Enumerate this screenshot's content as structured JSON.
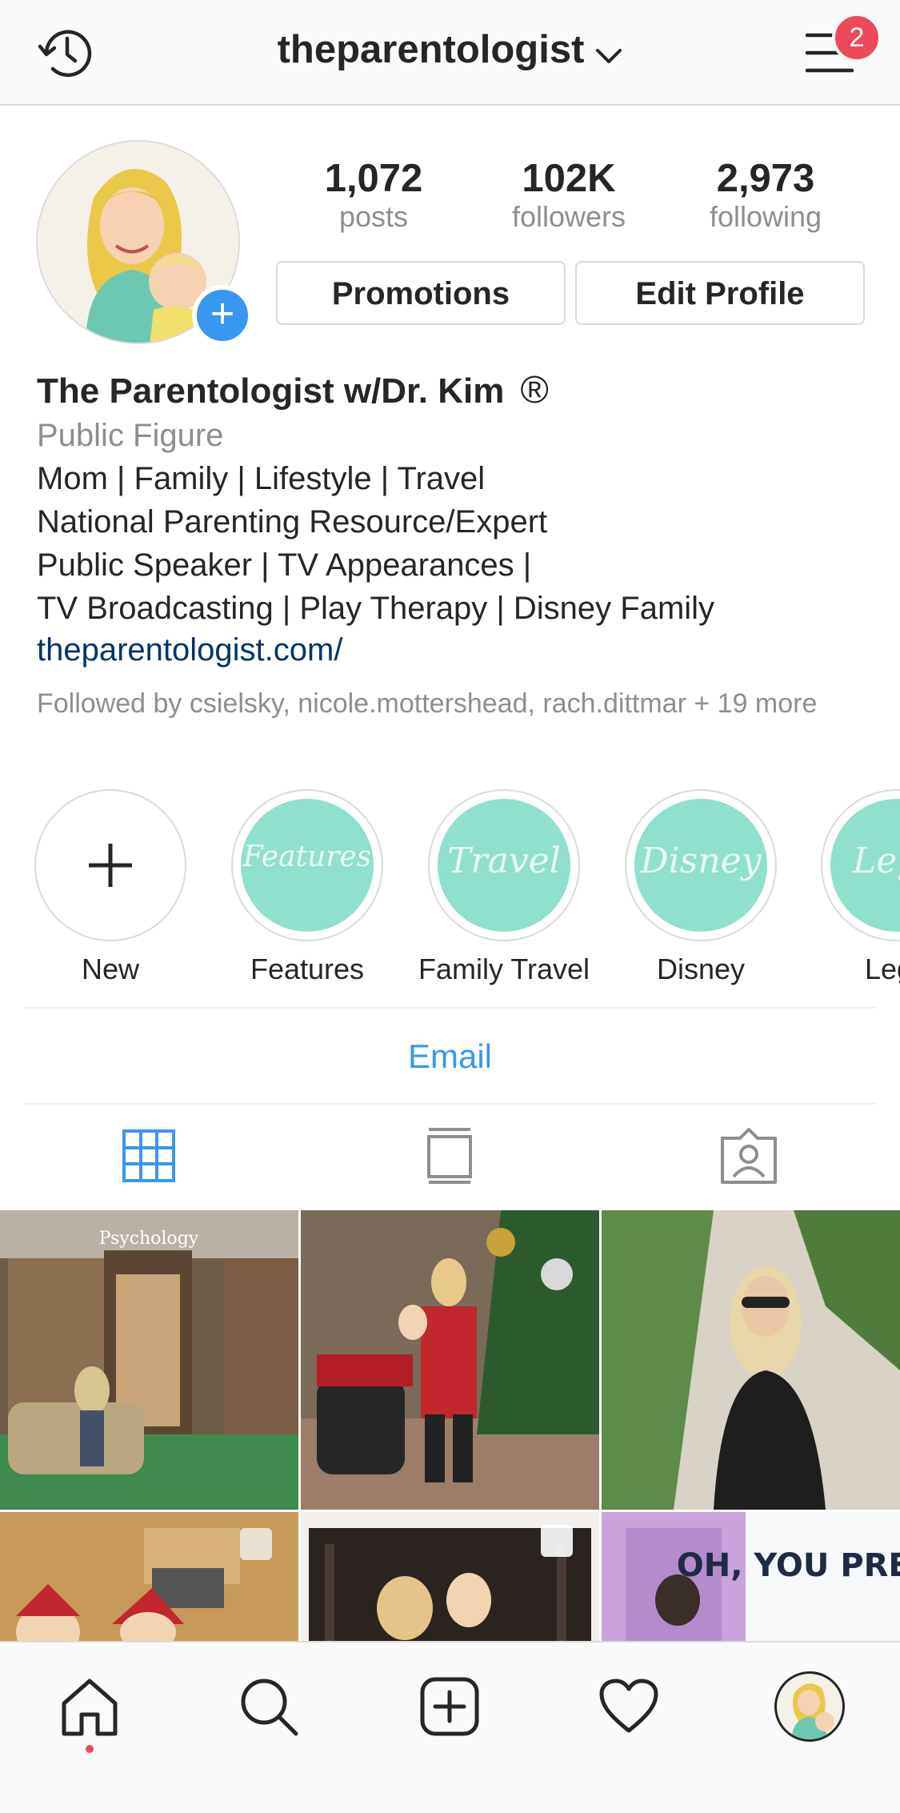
{
  "header": {
    "username": "theparentologist",
    "notification_count": "2"
  },
  "stats": [
    {
      "value": "1,072",
      "label": "posts"
    },
    {
      "value": "102K",
      "label": "followers"
    },
    {
      "value": "2,973",
      "label": "following"
    }
  ],
  "buttons": {
    "promotions": "Promotions",
    "edit_profile": "Edit Profile"
  },
  "profile": {
    "name": "The Parentologist w/Dr. Kim",
    "registered_mark": "®",
    "category": "Public Figure",
    "bio_lines": [
      "Mom | Family | Lifestyle | Travel",
      "National Parenting Resource/Expert",
      "Public Speaker | TV Appearances |",
      "TV Broadcasting | Play Therapy | Disney Family"
    ],
    "website": "theparentologist.com/",
    "followed_by": "Followed by csielsky, nicole.mottershead, rach.dittmar + 19 more"
  },
  "highlights": [
    {
      "label": "New",
      "cover_text": ""
    },
    {
      "label": "Features",
      "cover_text": "Features"
    },
    {
      "label": "Family Travel",
      "cover_text": "Travel"
    },
    {
      "label": "Disney",
      "cover_text": "Disney"
    },
    {
      "label": "Lego",
      "cover_text": "Lego"
    }
  ],
  "contact": {
    "email_label": "Email"
  },
  "colors": {
    "accent": "#3897f0",
    "badge": "#ed4956",
    "highlight_fill": "#8fe0cd",
    "link": "#003569"
  },
  "icons": {
    "top_left": "history-icon",
    "top_right": "menu-icon",
    "tabs": [
      "grid-icon",
      "feed-icon",
      "tagged-icon"
    ],
    "bottom_nav": [
      "home-icon",
      "search-icon",
      "new-post-icon",
      "heart-icon",
      "profile-avatar"
    ]
  },
  "posts_grid_text": {
    "post6_text": "OH, YOU PRETTY",
    "post1_text": "Psychology"
  }
}
